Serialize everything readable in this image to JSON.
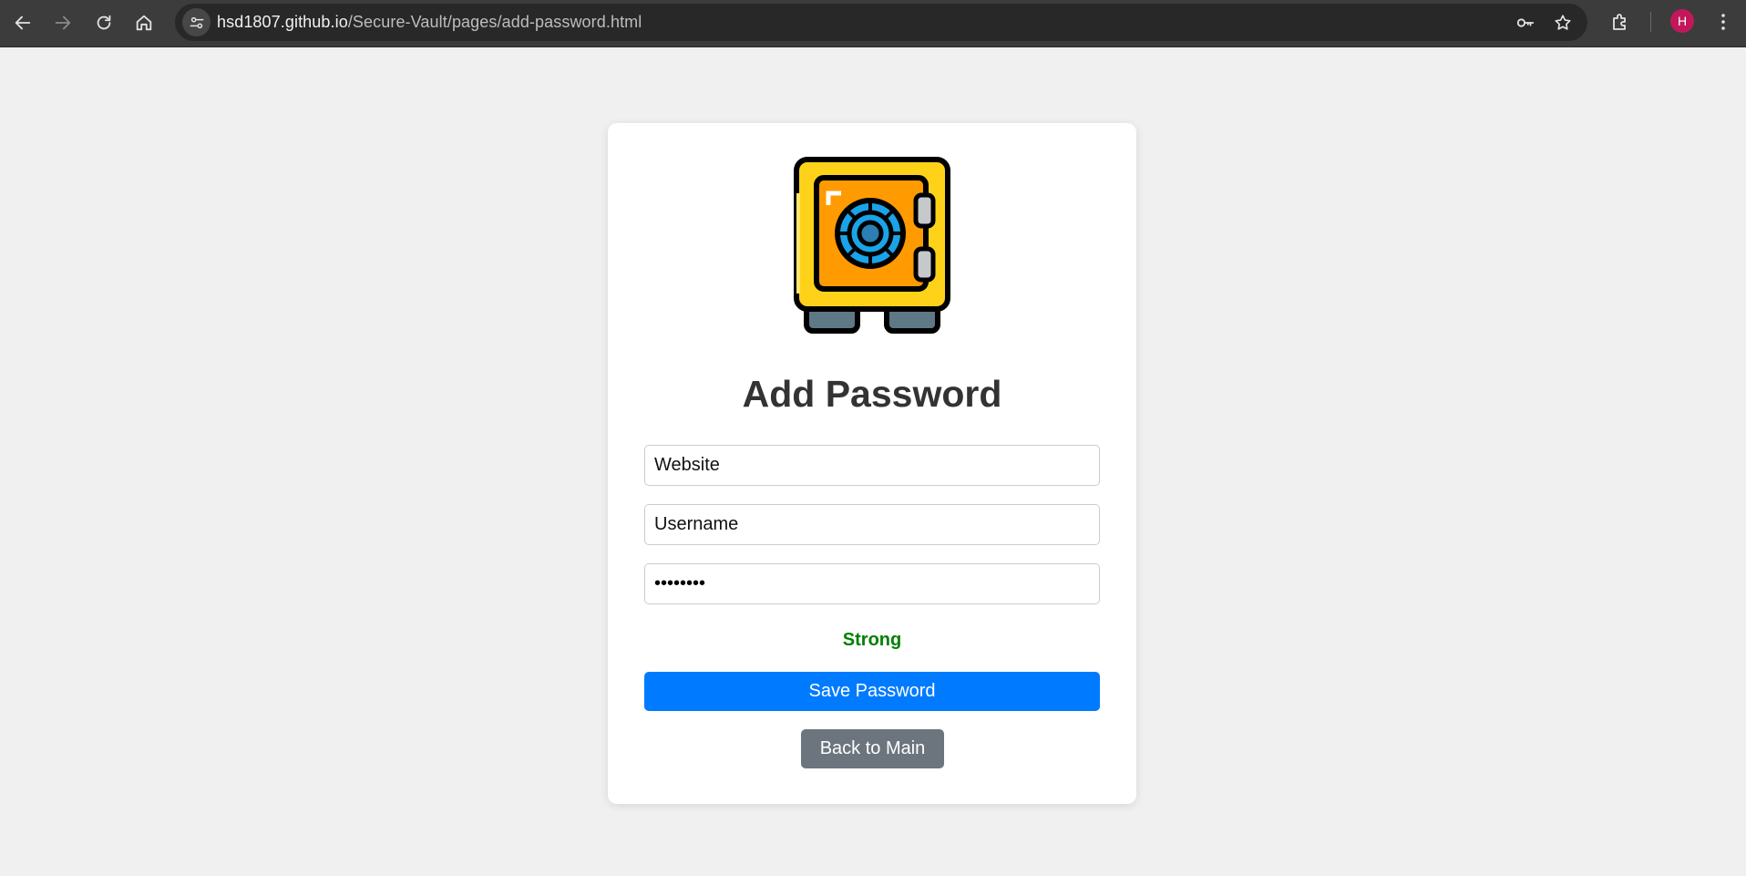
{
  "browser": {
    "url_host": "hsd1807.github.io",
    "url_path": "/Secure-Vault/pages/add-password.html",
    "profile_initial": "H",
    "icons": [
      "back-icon",
      "forward-icon",
      "reload-icon",
      "home-icon",
      "site-info-icon",
      "password-key-icon",
      "bookmark-star-icon",
      "extensions-icon",
      "menu-icon"
    ]
  },
  "form": {
    "title": "Add Password",
    "website_placeholder": "Website",
    "username_placeholder": "Username",
    "password_value": "strongpw",
    "strength_label": "Strong",
    "save_label": "Save Password",
    "back_label": "Back to Main"
  },
  "colors": {
    "page_bg": "#f0f0f0",
    "primary": "#007bff",
    "secondary": "#6c757d",
    "strength_strong": "#008000",
    "avatar": "#c2185b"
  }
}
